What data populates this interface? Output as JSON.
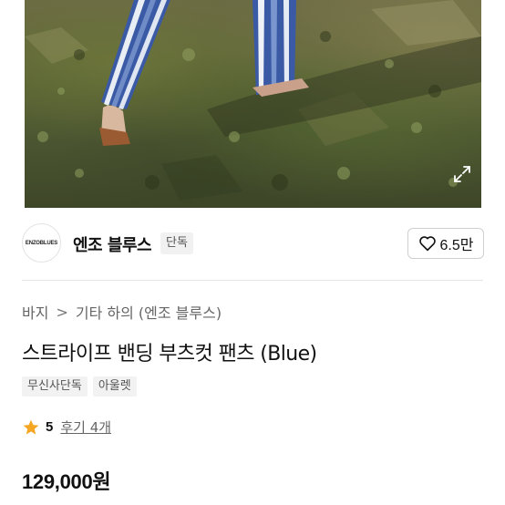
{
  "image": {
    "alt_icon": "expand-icon"
  },
  "brand": {
    "logo_text": "ENZOBLUES",
    "name": "엔조 블루스",
    "badge": "단독",
    "likes": "6.5만"
  },
  "breadcrumb": {
    "category": "바지",
    "separator": ">",
    "subcategory": "기타 하의 (엔조 블루스)"
  },
  "product": {
    "title": "스트라이프 밴딩 부츠컷 팬츠 (Blue)",
    "tags": [
      "무신사단독",
      "아울렛"
    ],
    "rating": "5",
    "review_label": "후기 4개",
    "price": "129,000원"
  },
  "colors": {
    "star": "#f5a623",
    "text": "#111111",
    "muted": "#666666"
  }
}
